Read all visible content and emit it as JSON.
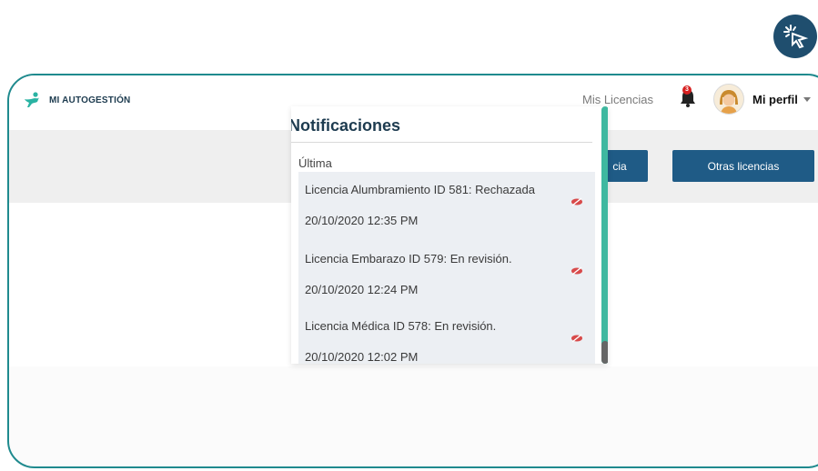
{
  "brand": {
    "name": "MI AUTOGESTIÓN"
  },
  "header": {
    "nav_link": "Mis Licencias",
    "bell_count": "3",
    "profile_label": "Mi perfil"
  },
  "buttons": {
    "primary_partial": "cia",
    "other_licenses": "Otras licencias"
  },
  "notifications": {
    "title": "Notificaciones",
    "section": "Última",
    "items": [
      {
        "message": "Licencia Alumbramiento ID 581: Rechazada",
        "date": "20/10/2020 12:35 PM"
      },
      {
        "message": "Licencia Embarazo ID 579: En revisión.",
        "date": "20/10/2020 12:24 PM"
      },
      {
        "message": "Licencia Médica ID 578: En revisión.",
        "date": "20/10/2020 12:02 PM"
      }
    ]
  },
  "colors": {
    "accent_teal": "#3fb8a0",
    "frame_teal": "#1f8a8e",
    "button_blue": "#1f5b86",
    "badge_red": "#d62020",
    "title_navy": "#1d3b4f"
  },
  "icons": {
    "badge": "pointer-click-icon",
    "logo": "person-jump-icon",
    "bell": "bell-icon",
    "avatar": "user-avatar-icon",
    "unread": "eye-slash-icon"
  }
}
